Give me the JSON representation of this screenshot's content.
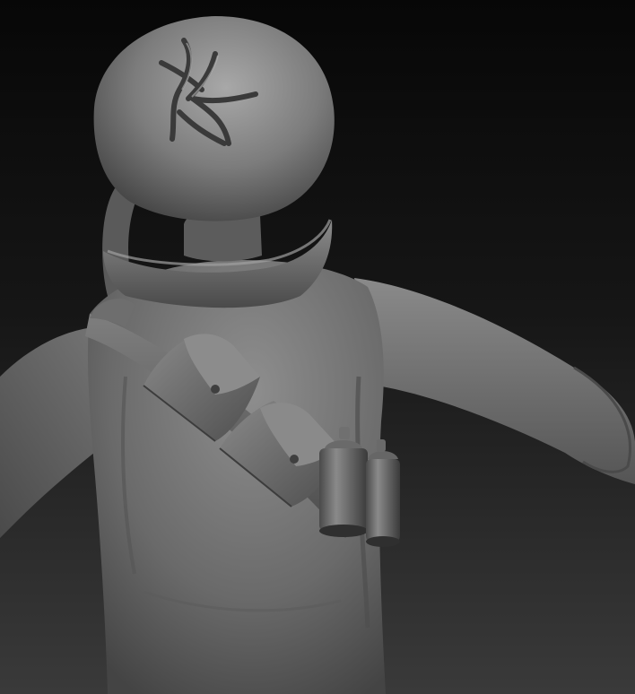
{
  "scene": {
    "subject": "sculpt-render",
    "palette": {
      "bg_top": "#0a0a0a",
      "bg_bottom": "#3a3a3a",
      "clay_light": "#9a9a9a",
      "clay_mid": "#6e6e6e",
      "clay_dark": "#3c3c3c",
      "clay_shadow": "#262626"
    },
    "icons": [
      "crack-mark-icon"
    ]
  }
}
